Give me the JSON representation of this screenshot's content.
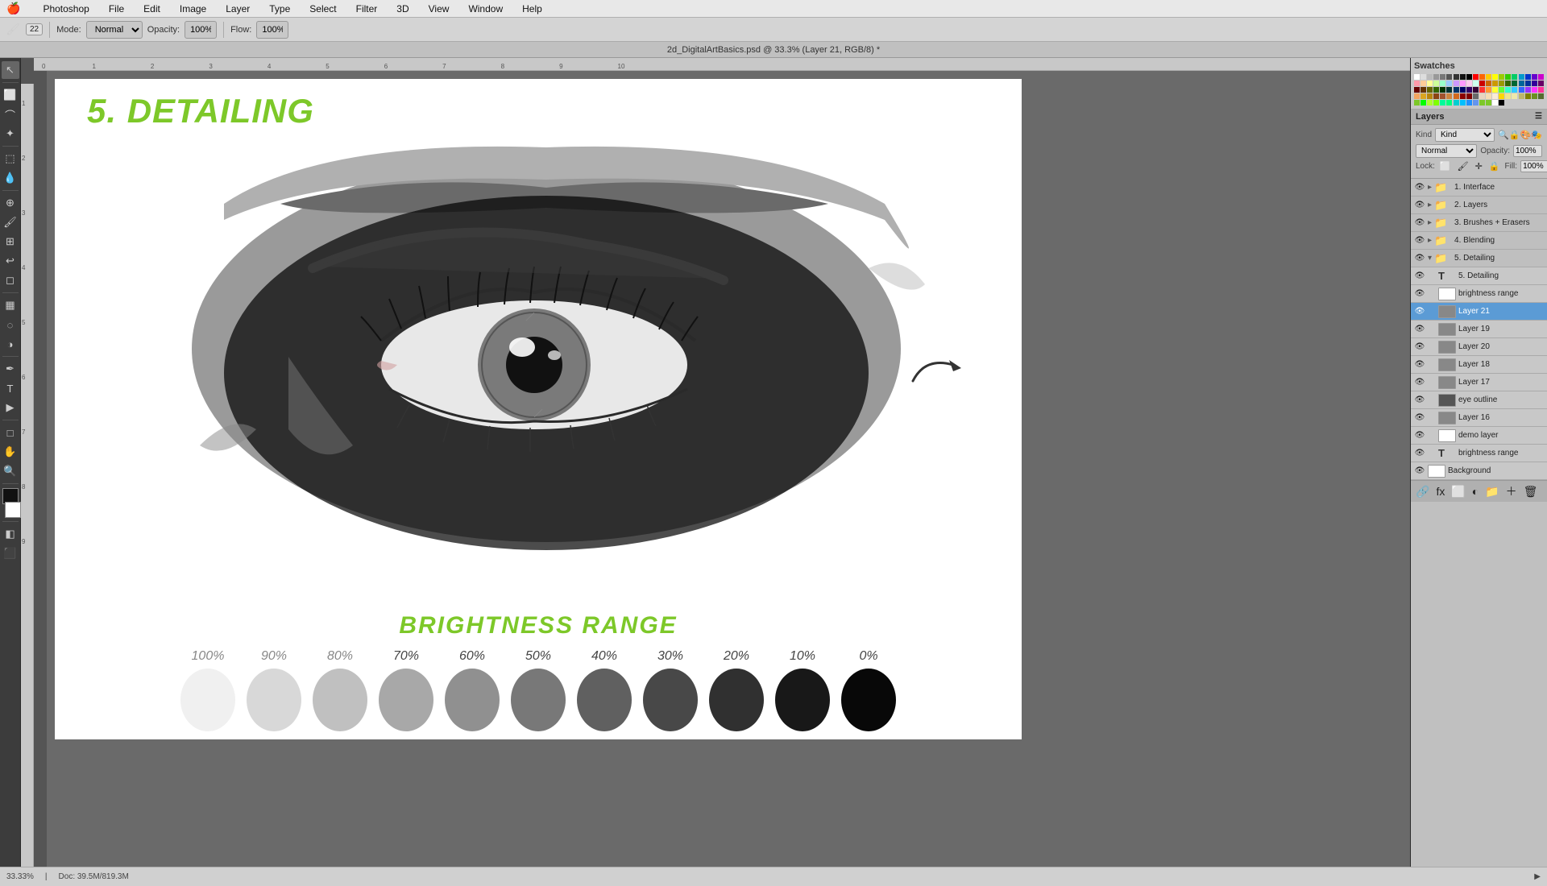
{
  "menubar": {
    "apple": "🍎",
    "items": [
      "Photoshop",
      "File",
      "Edit",
      "Image",
      "Layer",
      "Type",
      "Select",
      "Filter",
      "3D",
      "View",
      "Window",
      "Help"
    ]
  },
  "toolbar": {
    "mode_label": "Mode:",
    "mode_value": "Normal",
    "opacity_label": "Opacity:",
    "opacity_value": "100%",
    "flow_label": "Flow:",
    "flow_value": "100%"
  },
  "title_bar": {
    "text": "2d_DigitalArtBasics.psd @ 33.3% (Layer 21, RGB/8) *"
  },
  "canvas": {
    "art_title": "5. DETAILING",
    "brightness_title": "BRIGHTNESS RANGE",
    "swatches": [
      {
        "label": "100%",
        "bg": "#f0f0f0",
        "is_light": true
      },
      {
        "label": "90%",
        "bg": "#d8d8d8",
        "is_light": true
      },
      {
        "label": "80%",
        "bg": "#c0c0c0",
        "is_light": true
      },
      {
        "label": "70%",
        "bg": "#a8a8a8",
        "is_light": false
      },
      {
        "label": "60%",
        "bg": "#909090",
        "is_light": false
      },
      {
        "label": "50%",
        "bg": "#787878",
        "is_light": false
      },
      {
        "label": "40%",
        "bg": "#606060",
        "is_light": false
      },
      {
        "label": "30%",
        "bg": "#484848",
        "is_light": false
      },
      {
        "label": "20%",
        "bg": "#303030",
        "is_light": false
      },
      {
        "label": "10%",
        "bg": "#181818",
        "is_light": false
      },
      {
        "label": "0%",
        "bg": "#080808",
        "is_light": false
      }
    ]
  },
  "layers_panel": {
    "title": "Layers",
    "kind_placeholder": "Kind",
    "mode": "Normal",
    "opacity": "100%",
    "fill": "100%",
    "lock_label": "Lock:",
    "items": [
      {
        "name": "1. Interface",
        "type": "folder",
        "visible": true,
        "color": "green",
        "indent": false
      },
      {
        "name": "2. Layers",
        "type": "folder",
        "visible": true,
        "color": "green",
        "indent": false
      },
      {
        "name": "3. Brushes + Erasers",
        "type": "folder",
        "visible": true,
        "color": "green",
        "indent": false
      },
      {
        "name": "4. Blending",
        "type": "folder",
        "visible": true,
        "color": "green",
        "indent": false
      },
      {
        "name": "5. Detailing",
        "type": "folder",
        "visible": true,
        "color": "green",
        "indent": false,
        "expanded": true
      },
      {
        "name": "5. Detailing",
        "type": "text",
        "visible": true,
        "color": "white",
        "indent": true
      },
      {
        "name": "brightness range",
        "type": "layer",
        "visible": true,
        "color": "white",
        "indent": true
      },
      {
        "name": "Layer 21",
        "type": "layer",
        "visible": true,
        "color": "gray",
        "indent": true,
        "active": true
      },
      {
        "name": "Layer 19",
        "type": "layer",
        "visible": true,
        "color": "gray",
        "indent": true
      },
      {
        "name": "Layer 20",
        "type": "layer",
        "visible": true,
        "color": "gray",
        "indent": true
      },
      {
        "name": "Layer 18",
        "type": "layer",
        "visible": true,
        "color": "gray",
        "indent": true
      },
      {
        "name": "Layer 17",
        "type": "layer",
        "visible": true,
        "color": "gray",
        "indent": true
      },
      {
        "name": "eye outline",
        "type": "layer",
        "visible": true,
        "color": "dark",
        "indent": true
      },
      {
        "name": "Layer 16",
        "type": "layer",
        "visible": true,
        "color": "gray",
        "indent": true
      },
      {
        "name": "demo layer",
        "type": "layer",
        "visible": true,
        "color": "white",
        "indent": true
      },
      {
        "name": "brightness range",
        "type": "text",
        "visible": true,
        "color": "white",
        "indent": true
      },
      {
        "name": "Background",
        "type": "layer",
        "visible": true,
        "color": "white",
        "indent": false
      }
    ]
  },
  "statusbar": {
    "zoom": "33.33%",
    "doc_size": "Doc: 39.5M/819.3M"
  }
}
